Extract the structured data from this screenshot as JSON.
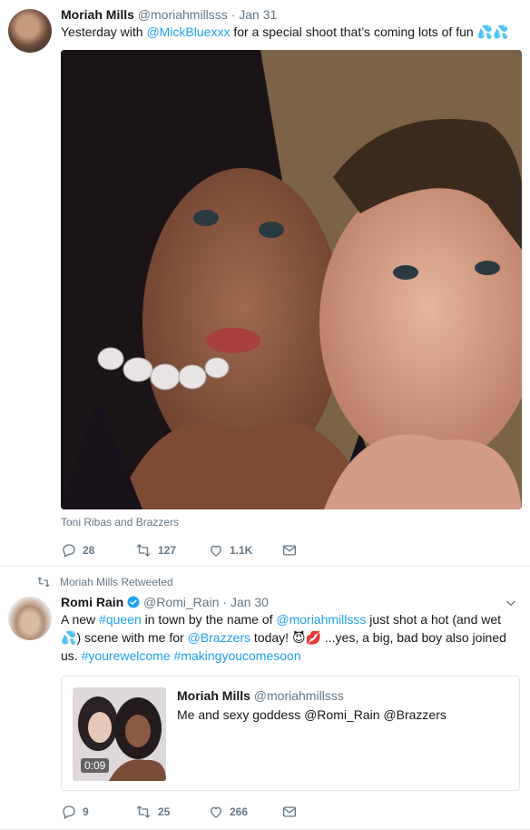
{
  "tweet1": {
    "name": "Moriah Mills",
    "handle": "@moriahmillsss",
    "separator": "·",
    "date": "Jan 31",
    "text_before": "Yesterday with ",
    "mention": "@MickBluexxx",
    "text_after": " for a special shoot that’s coming lots of fun ",
    "emoji": "💦💦",
    "media_caption": "Toni Ribas and Brazzers",
    "replies": "28",
    "retweets": "127",
    "likes": "1.1K"
  },
  "tweet2": {
    "context": "Moriah Mills Retweeted",
    "name": "Romi Rain",
    "handle": "@Romi_Rain",
    "separator": "·",
    "date": "Jan 30",
    "t1": "A new ",
    "hashtag_queen": "#queen",
    "t2": " in town by the name of ",
    "mention_moriah": "@moriahmillsss",
    "t3": " just shot a hot (and wet ",
    "emoji_drop": "💦",
    "t4": ") scene with me for ",
    "mention_brazzers": "@Brazzers",
    "t5": " today! ",
    "emoji_devil_kiss": "😈💋",
    "t6": " ...yes, a big, bad boy also joined us. ",
    "hashtag_welcome": "#yourewelcome",
    "t7": " ",
    "hashtag_coming": "#makingyoucomesoon",
    "quote": {
      "name": "Moriah Mills",
      "handle": "@moriahmillsss",
      "text": "Me and sexy goddess @Romi_Rain  @Brazzers",
      "duration": "0:09"
    },
    "replies": "9",
    "retweets": "25",
    "likes": "266"
  },
  "colors": {
    "link": "#1da1f2",
    "muted": "#657786",
    "verified": "#1da1f2"
  },
  "icons": [
    "reply-icon",
    "retweet-icon",
    "like-icon",
    "dm-icon",
    "chevron-down-icon",
    "verified-badge-icon"
  ]
}
